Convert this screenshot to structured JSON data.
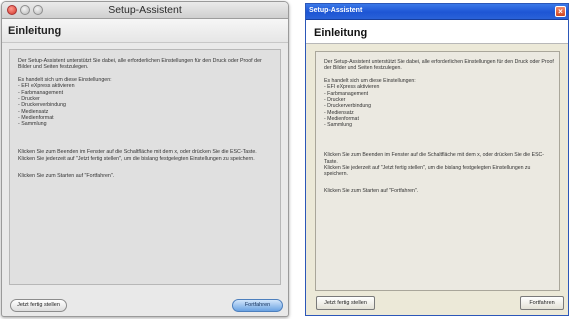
{
  "mac": {
    "title": "Setup-Assistent",
    "heading": "Einleitung",
    "intro": "Der Setup-Assistent unterstützt Sie dabei, alle erforderlichen Einstellungen für den Druck oder Proof der Bilder und Seiten festzulegen.",
    "list_title": "Es handelt sich um diese Einstellungen:",
    "items": [
      "- EFI eXpress aktivieren",
      "- Farbmanagement",
      "- Drucker",
      "- Druckerverbindung",
      "- Mediensatz",
      "- Medienformat",
      "- Sammlung"
    ],
    "para_close": "Klicken Sie zum Beenden im Fenster auf die Schaltfläche mit dem x, oder drücken Sie die ESC-Taste.",
    "para_save": "Klicken Sie jederzeit auf \"Jetzt fertig stellen\", um die bislang festgelegten Einstellungen zu speichern.",
    "para_start": "Klicken Sie zum Starten auf \"Fortfahren\".",
    "btn_finish": "Jetzt fertig stellen",
    "btn_continue": "Fortfahren"
  },
  "win": {
    "title": "Setup-Assistent",
    "heading": "Einleitung",
    "intro": "Der Setup-Assistent unterstützt Sie dabei, alle erforderlichen Einstellungen für den Druck oder Proof der Bilder und Seiten festzulegen.",
    "list_title": "Es handelt sich um diese Einstellungen:",
    "items": [
      "- EFI eXpress aktivieren",
      "- Farbmanagement",
      "- Drucker",
      "- Druckerverbindung",
      "- Mediensatz",
      "- Medienformat",
      "- Sammlung"
    ],
    "para_close": "Klicken Sie zum Beenden im Fenster auf die Schaltfläche mit dem x, oder drücken Sie die ESC-Taste.",
    "para_save": "Klicken Sie jederzeit auf \"Jetzt fertig stellen\", um die bislang festgelegten Einstellungen zu speichern.",
    "para_start": "Klicken Sie zum Starten auf \"Fortfahren\".",
    "btn_finish": "Jetzt fertig stellen",
    "btn_continue": "Fortfahren",
    "close_glyph": "×"
  },
  "colors": {
    "mac_default_button": "#6aa2e2",
    "win_titlebar": "#1d55d4",
    "win_close": "#d0451f"
  }
}
